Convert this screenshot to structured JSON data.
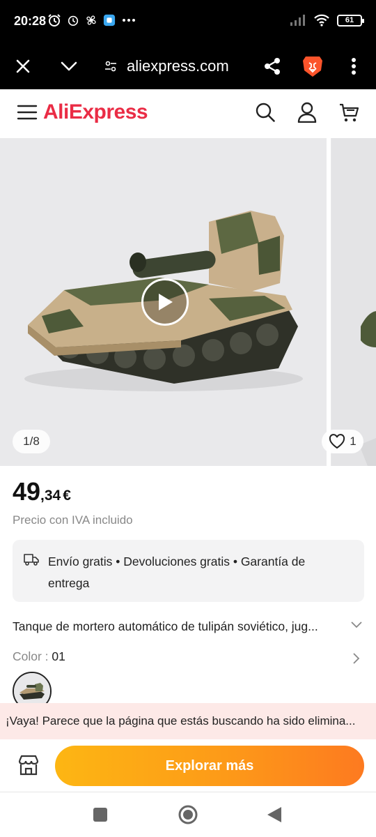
{
  "status_bar": {
    "time": "20:28",
    "battery": "61",
    "left_icons": [
      "alarm-clock-icon",
      "alarm-icon",
      "fan-icon",
      "app-icon",
      "more-notifications-icon"
    ],
    "right_icons": [
      "signal-icon",
      "wifi-icon",
      "battery-icon"
    ]
  },
  "browser": {
    "url": "aliexpress.com",
    "url_display": "aliexpress.com",
    "icons": [
      "close-icon",
      "chevron-down-icon",
      "site-settings-icon",
      "share-icon",
      "brave-lion-icon",
      "more-vert-icon"
    ]
  },
  "header": {
    "logo": "AliExpress",
    "icons": [
      "menu-icon",
      "search-icon",
      "account-icon",
      "cart-icon"
    ]
  },
  "gallery": {
    "counter": "1/8",
    "likes": "1"
  },
  "product": {
    "price_integer": "49",
    "price_decimal": ",34",
    "currency": "€",
    "tax_note": "Precio con IVA incluido",
    "shipping_text": "Envío gratis • Devoluciones gratis • Garantía de entrega",
    "title": "Tanque de mortero automático de tulipán soviético, juguete de metal fundido a presión",
    "title_display": "Tanque de mortero automático de tulipán soviético, jug...",
    "color_label": "Color :",
    "color_value": " 01"
  },
  "alert": {
    "text": "¡Vaya! Parece que la página que estás buscando ha sido elimina..."
  },
  "bottom": {
    "explore_label": "Explorar más"
  },
  "colors": {
    "brand": "#ea2c45",
    "explore_start": "#fdb613",
    "explore_end": "#fd7a20",
    "alert_bg": "#fde9e7"
  }
}
